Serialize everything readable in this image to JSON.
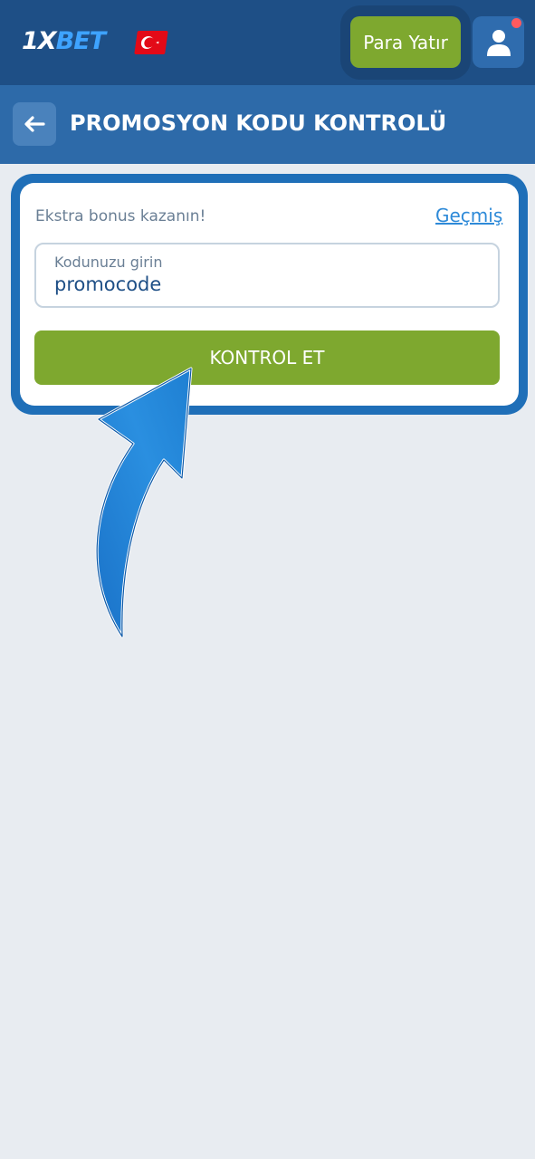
{
  "header": {
    "logo_prefix": "1X",
    "logo_suffix": "BET",
    "flag_icon": "turkey-flag-icon",
    "deposit_label": "Para Yatır",
    "profile_icon": "user-icon",
    "has_notification": true
  },
  "subheader": {
    "back_icon": "arrow-left-icon",
    "title": "PROMOSYON KODU KONTROLÜ"
  },
  "promo_card": {
    "bonus_text": "Ekstra bonus kazanın!",
    "history_link": "Geçmiş",
    "code_field": {
      "label": "Kodunuzu girin",
      "value": "promocode"
    },
    "check_button": "KONTROL ET"
  },
  "colors": {
    "header_bg": "#1e4f86",
    "subheader_bg": "#2d6aa9",
    "accent_green": "#7ea82f",
    "card_outline": "#1f6fb8",
    "page_bg": "#e8ecf1"
  }
}
